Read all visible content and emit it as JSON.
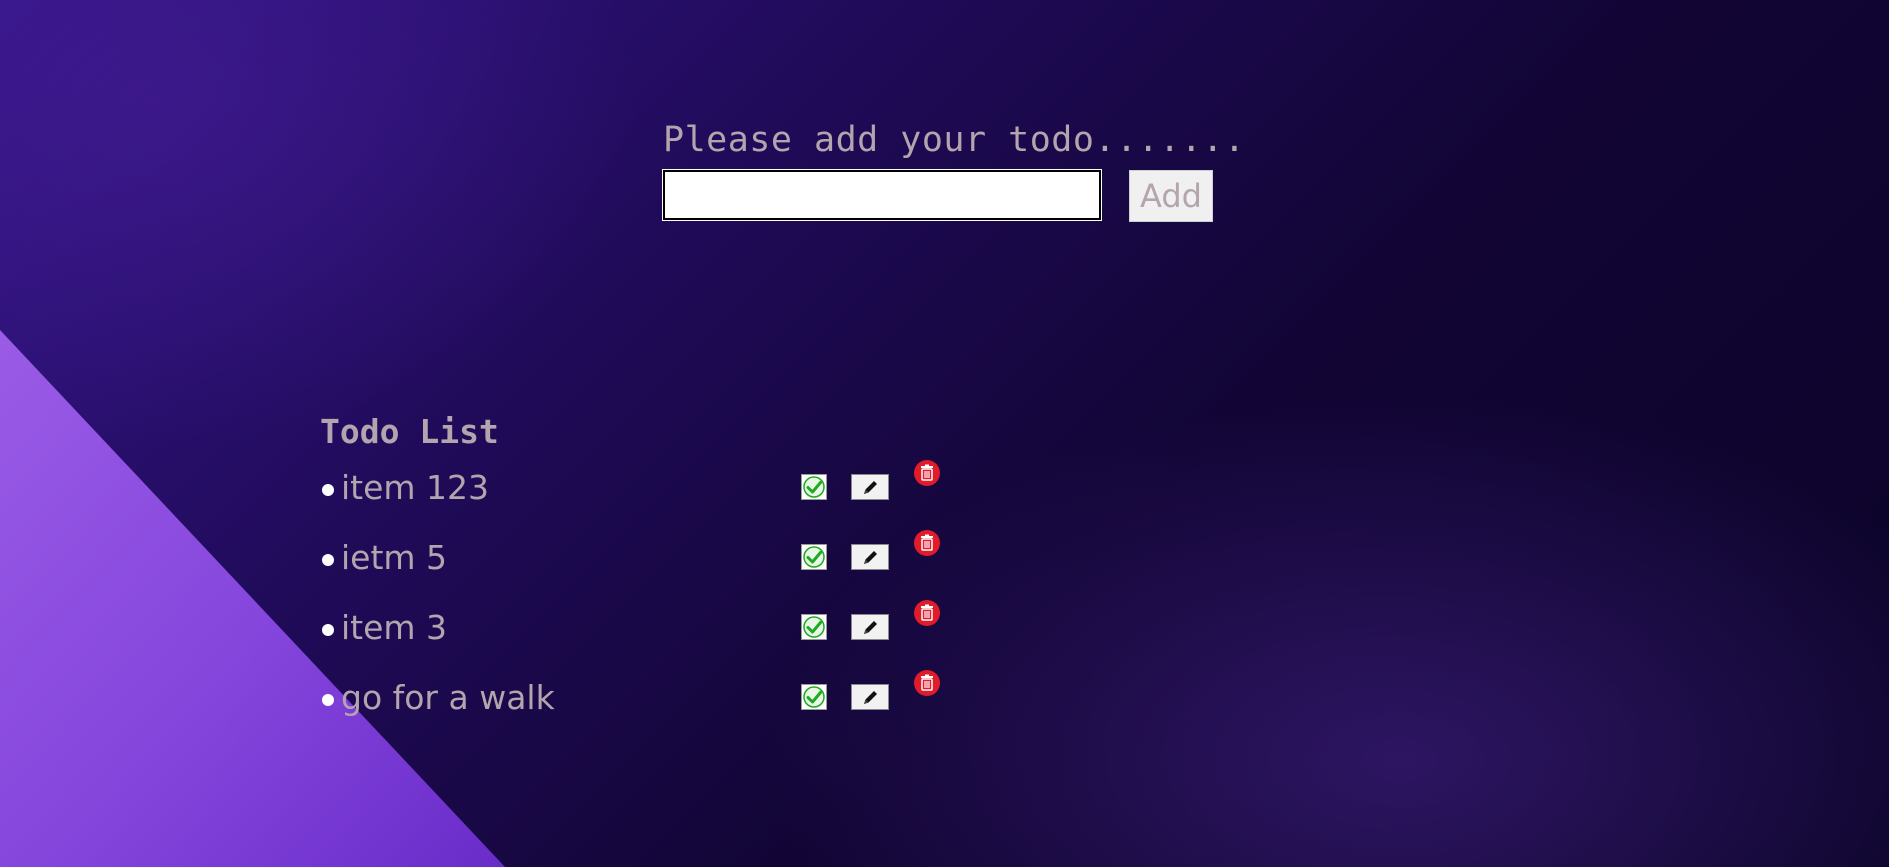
{
  "add_form": {
    "prompt": "Please add your todo.......",
    "input_value": "",
    "input_placeholder": "",
    "add_label": "Add"
  },
  "todo_list": {
    "title": "Todo List",
    "items": [
      {
        "text": "item 123"
      },
      {
        "text": "ietm 5"
      },
      {
        "text": "item 3"
      },
      {
        "text": "go for a walk"
      }
    ]
  },
  "icons": {
    "complete": "check-icon",
    "edit": "pencil-icon",
    "delete": "trash-icon"
  },
  "colors": {
    "text": "#b3a4ad",
    "check": "#1faa1f",
    "delete": "#e01b2a",
    "accent_wedge": "#8a4fe0"
  }
}
